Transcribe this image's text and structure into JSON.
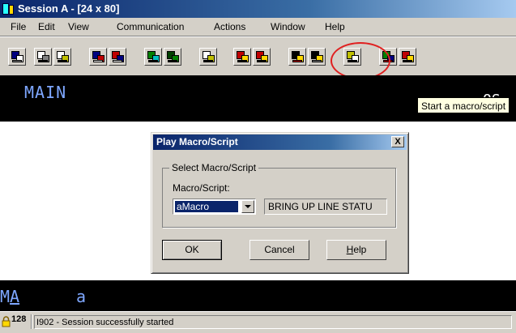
{
  "window": {
    "title": "Session A - [24 x 80]"
  },
  "menu": {
    "items": [
      "File",
      "Edit",
      "View",
      "Communication",
      "Actions",
      "Window",
      "Help"
    ]
  },
  "toolbar": {
    "buttons": [
      {
        "name": "display-setup",
        "colors": [
          "#000080",
          "#ffffff",
          "#808080"
        ]
      },
      {
        "name": "copy",
        "colors": [
          "#ffffff",
          "#808080",
          "#000000"
        ]
      },
      {
        "name": "paste",
        "colors": [
          "#ffffff",
          "#c0c000",
          "#000000"
        ]
      },
      {
        "name": "send-file",
        "colors": [
          "#000080",
          "#c00000",
          "#ffffff"
        ]
      },
      {
        "name": "receive-file",
        "colors": [
          "#c00000",
          "#000080",
          "#ffffff"
        ]
      },
      {
        "name": "keypad",
        "colors": [
          "#008000",
          "#00c0c0",
          "#000000"
        ]
      },
      {
        "name": "keypad2",
        "colors": [
          "#004000",
          "#008000",
          "#000000"
        ]
      },
      {
        "name": "map",
        "colors": [
          "#ffffff",
          "#c0c000",
          "#000000"
        ]
      },
      {
        "name": "record-macro",
        "colors": [
          "#c00000",
          "#ffd800",
          "#000000"
        ]
      },
      {
        "name": "stop-macro",
        "colors": [
          "#c00000",
          "#ffd800",
          "#000000"
        ]
      },
      {
        "name": "play-macro",
        "colors": [
          "#000000",
          "#ffd800",
          "#c00000"
        ]
      },
      {
        "name": "macro2",
        "colors": [
          "#000000",
          "#ffd800",
          "#808080"
        ]
      },
      {
        "name": "clipboard",
        "colors": [
          "#c0c000",
          "#ffffff",
          "#000000"
        ]
      },
      {
        "name": "globe",
        "colors": [
          "#008000",
          "#000080",
          "#c00000"
        ]
      },
      {
        "name": "pencil",
        "colors": [
          "#c00000",
          "#ffd800",
          "#000000"
        ]
      }
    ],
    "tooltip": "Start a macro/script"
  },
  "terminal_top": {
    "left_text": "MAIN",
    "right_text": "OS."
  },
  "dialog": {
    "title": "Play Macro/Script",
    "close_label": "X",
    "group_label": "Select Macro/Script",
    "macro_label": "Macro/Script:",
    "macro_value": "aMacro",
    "macro_description": "BRING UP LINE STATU",
    "ok_label": "OK",
    "cancel_label": "Cancel",
    "help_label": "Help"
  },
  "terminal_bottom": {
    "left_text_a": "M",
    "left_text_b": "A",
    "cursor_text": "a"
  },
  "status": {
    "number": "128",
    "message": "I902 - Session successfully started"
  },
  "colors": {
    "title_bar": "#0a246a",
    "terminal_bg": "#000000",
    "terminal_text": "#7ea7ff",
    "highlight_circle": "#e02020"
  }
}
